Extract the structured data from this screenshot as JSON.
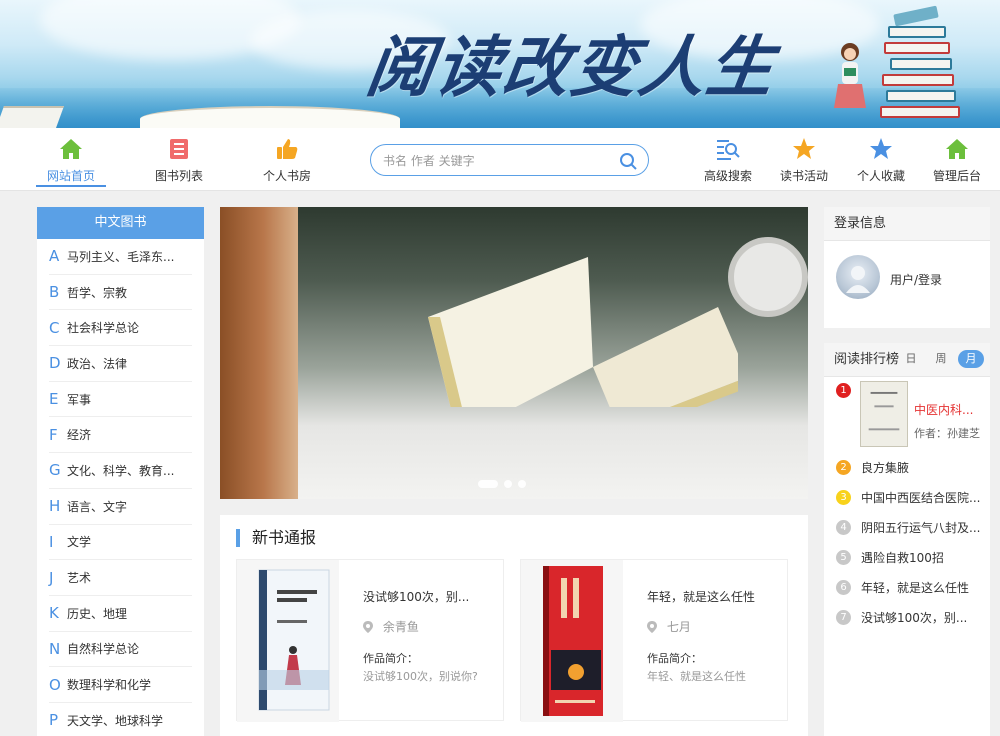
{
  "banner": {
    "slogan": "阅读改变人生"
  },
  "nav": {
    "home": "网站首页",
    "book_list": "图书列表",
    "my_study": "个人书房",
    "search_placeholder": "书名 作者 关键字",
    "advanced_search": "高级搜索",
    "reading_activity": "读书活动",
    "favorites": "个人收藏",
    "admin": "管理后台"
  },
  "categories": {
    "title": "中文图书",
    "items": [
      {
        "letter": "A",
        "name": "马列主义、毛泽东..."
      },
      {
        "letter": "B",
        "name": "哲学、宗教"
      },
      {
        "letter": "C",
        "name": "社会科学总论"
      },
      {
        "letter": "D",
        "name": "政治、法律"
      },
      {
        "letter": "E",
        "name": "军事"
      },
      {
        "letter": "F",
        "name": "经济"
      },
      {
        "letter": "G",
        "name": "文化、科学、教育..."
      },
      {
        "letter": "H",
        "name": "语言、文字"
      },
      {
        "letter": "I",
        "name": "文学"
      },
      {
        "letter": "J",
        "name": "艺术"
      },
      {
        "letter": "K",
        "name": "历史、地理"
      },
      {
        "letter": "N",
        "name": "自然科学总论"
      },
      {
        "letter": "O",
        "name": "数理科学和化学"
      },
      {
        "letter": "P",
        "name": "天文学、地球科学"
      }
    ]
  },
  "new_books": {
    "title": "新书通报",
    "items": [
      {
        "title": "没试够100次，别...",
        "author": "余青鱼",
        "intro_label": "作品简介：",
        "intro": "没试够100次，别说你?"
      },
      {
        "title": "年轻，就是这么任性",
        "author": "七月",
        "intro_label": "作品简介：",
        "intro": "年轻、就是这么任性"
      }
    ]
  },
  "login": {
    "title": "登录信息",
    "link": "用户/登录"
  },
  "ranking": {
    "title": "阅读排行榜",
    "tabs": [
      "日",
      "周",
      "月"
    ],
    "active_tab": "月",
    "first": {
      "rank": "1",
      "title": "中医内科...",
      "author": "作者：孙建芝"
    },
    "items": [
      {
        "rank": "2",
        "name": "良方集腋",
        "color": "#f5a623"
      },
      {
        "rank": "3",
        "name": "中国中西医结合医院...",
        "color": "#f8d21c"
      },
      {
        "rank": "4",
        "name": "阴阳五行运气八封及...",
        "color": "#c8c8c8"
      },
      {
        "rank": "5",
        "name": "遇险自救100招",
        "color": "#c8c8c8"
      },
      {
        "rank": "6",
        "name": "年轻，就是这么任性",
        "color": "#c8c8c8"
      },
      {
        "rank": "7",
        "name": "没试够100次，别...",
        "color": "#c8c8c8"
      }
    ]
  },
  "colors": {
    "accent": "#5aa0e6",
    "rank_first": "#e02020",
    "highlight_red": "#e53333"
  }
}
